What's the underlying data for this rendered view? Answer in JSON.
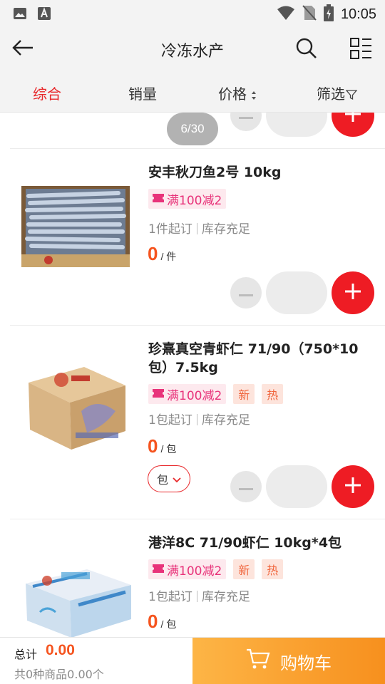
{
  "status_bar": {
    "time": "10:05",
    "icons": [
      "image-icon",
      "font-a-icon",
      "wifi-icon",
      "no-sim-icon",
      "battery-icon"
    ]
  },
  "header": {
    "title": "冷冻水产",
    "icons": [
      "back-arrow-icon",
      "search-icon",
      "grid-list-icon"
    ]
  },
  "sort_tabs": [
    {
      "label": "综合",
      "active": true
    },
    {
      "label": "销量",
      "active": false
    },
    {
      "label": "价格",
      "active": false
    },
    {
      "label": "筛选",
      "active": false
    }
  ],
  "page_indicator": "6/30",
  "products": [
    {
      "name": "安丰秋刀鱼2号  10kg",
      "coupon": "满100减2",
      "tags": [],
      "min_order": "1件起订",
      "stock": "库存充足",
      "price": "0",
      "unit": "/ 件",
      "unit_select": null
    },
    {
      "name": "珍熹真空青虾仁 71/90（750*10包）7.5kg",
      "coupon": "满100减2",
      "tags": [
        "新",
        "热"
      ],
      "min_order": "1包起订",
      "stock": "库存充足",
      "price": "0",
      "unit": "/ 包",
      "unit_select": "包"
    },
    {
      "name": "港洋8C  71/90虾仁  10kg*4包",
      "coupon": "满100减2",
      "tags": [
        "新",
        "热"
      ],
      "min_order": "1包起订",
      "stock": "库存充足",
      "price": "0",
      "unit": "/ 包",
      "unit_select": null
    }
  ],
  "bottom_bar": {
    "total_label": "总计",
    "total_value": "0.00",
    "summary": "共0种商品0.00个",
    "cart_label": "购物车"
  },
  "colors": {
    "accent_red": "#ee1c24",
    "price_orange": "#f5541f",
    "coupon_pink": "#e8337a",
    "cart_gradient_start": "#fdb546",
    "cart_gradient_end": "#f7901e"
  }
}
